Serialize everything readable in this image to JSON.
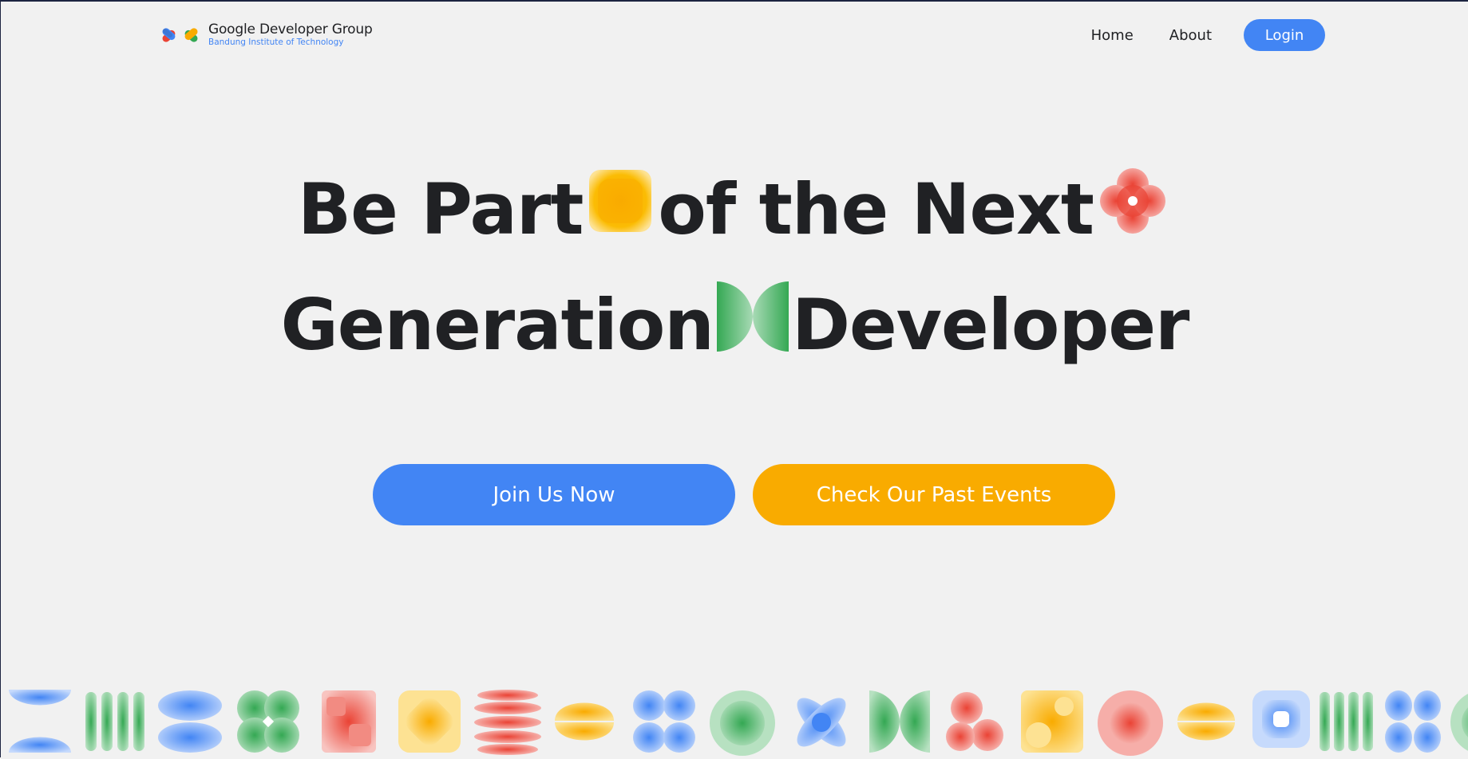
{
  "header": {
    "brand_title": "Google Developer Group",
    "brand_subtitle": "Bandung Institute of Technology",
    "nav": {
      "home": "Home",
      "about": "About",
      "login": "Login"
    }
  },
  "hero": {
    "line1_part1": "Be Part",
    "line1_part2": "of the Next",
    "line2_part1": "Generation",
    "line2_part2": "Developer"
  },
  "actions": {
    "join_label": "Join Us Now",
    "past_events_label": "Check Our Past Events"
  },
  "colors": {
    "blue": "#4285f4",
    "yellow": "#f9ab00",
    "green": "#34a853",
    "red": "#ea4335",
    "background": "#f1f1f1",
    "text": "#202124"
  },
  "decor_strip": [
    "half-circles-icon",
    "vertical-bars-icon",
    "ellipses-icon",
    "clover-icon",
    "squares-icon",
    "rounded-diamond-icon",
    "stacked-pills-icon",
    "ellipses-icon",
    "four-circles-icon",
    "ring-circle-icon",
    "petal-cross-icon",
    "bowtie-icon",
    "blob-icon",
    "square-dots-icon",
    "ring-circle-icon",
    "ellipses-icon",
    "rounded-square-ring-icon",
    "vertical-bars-icon",
    "four-circles-icon",
    "circle-icon"
  ]
}
